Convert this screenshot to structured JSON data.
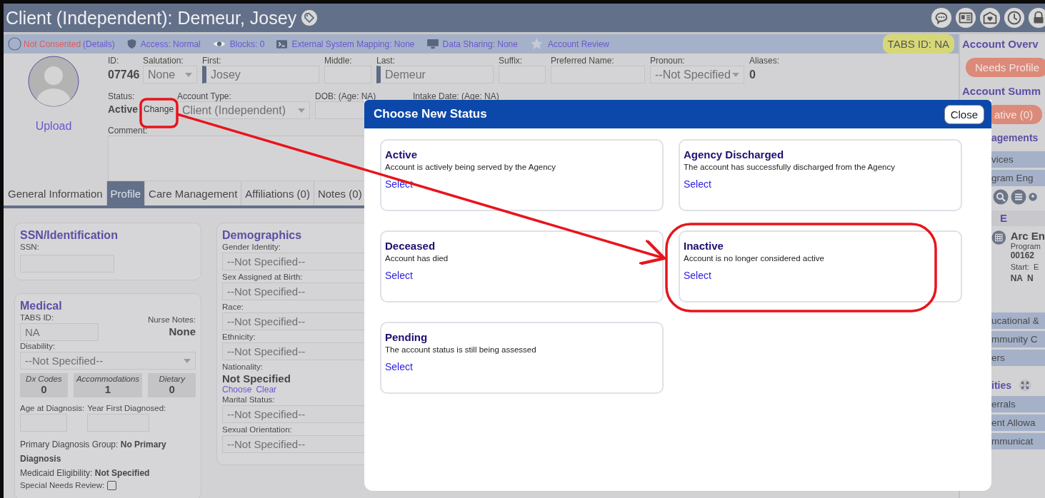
{
  "window": {
    "title": "Client (Independent): Demeur, Josey"
  },
  "info_bar": {
    "consent": {
      "label": "Not Consented",
      "link": "(Details)"
    },
    "items": [
      {
        "kind": "access",
        "label": "Access: Normal"
      },
      {
        "kind": "blocks",
        "label": "Blocks: 0"
      },
      {
        "kind": "external",
        "label": "External System Mapping: None"
      },
      {
        "kind": "sharing",
        "label": "Data Sharing: None"
      },
      {
        "kind": "review",
        "label": "Account Review"
      }
    ],
    "tabs_id": "TABS ID: NA"
  },
  "profile": {
    "upload": "Upload",
    "id": {
      "label": "ID:",
      "value": "07746"
    },
    "salutation": {
      "label": "Salutation:",
      "value": "None"
    },
    "first": {
      "label": "First:",
      "value": "Josey"
    },
    "middle": {
      "label": "Middle:"
    },
    "last": {
      "label": "Last:",
      "value": "Demeur"
    },
    "suffix": {
      "label": "Suffix:"
    },
    "preferred_name": {
      "label": "Preferred Name:"
    },
    "pronoun": {
      "label": "Pronoun:",
      "value": "--Not Specified"
    },
    "aliases": {
      "label": "Aliases:",
      "value": "0"
    },
    "status": {
      "label": "Status:",
      "value": "Active",
      "button": "Change"
    },
    "account_type": {
      "label": "Account Type:",
      "value": "Client (Independent)"
    },
    "dob": {
      "label": "DOB: (Age: NA)"
    },
    "intake_date": {
      "label": "Intake Date: (Age: NA)"
    },
    "comment": {
      "label": "Comment:"
    }
  },
  "tabs": [
    {
      "label": "General Information",
      "selected": false
    },
    {
      "label": "Profile",
      "selected": true
    },
    {
      "label": "Care Management",
      "selected": false
    },
    {
      "label": "Affiliations (0)",
      "selected": false
    },
    {
      "label": "Notes (0)",
      "selected": false
    }
  ],
  "ssn": {
    "title": "SSN/Identification",
    "label": "SSN:"
  },
  "medical": {
    "title": "Medical",
    "tabs_id": {
      "label": "TABS ID:",
      "value": "NA"
    },
    "nurse_notes": {
      "label": "Nurse Notes:",
      "value": "None"
    },
    "disability": {
      "label": "Disability:",
      "value": "--Not Specified--"
    },
    "counts": [
      {
        "label": "Dx Codes",
        "value": "0"
      },
      {
        "label": "Accommodations",
        "value": "1"
      },
      {
        "label": "Dietary",
        "value": "0"
      }
    ],
    "age_at_diagnosis": {
      "label": "Age at Diagnosis:"
    },
    "year_first_diagnosed": {
      "label": "Year First Diagnosed:"
    },
    "primary_diagnosis": "Primary Diagnosis Group: **No Primary Diagnosis**",
    "medicaid": "Medicaid Eligibility: **Not Specified**",
    "special_needs": {
      "label": "Special Needs Review:",
      "checked": false
    }
  },
  "demographics": {
    "title": "Demographics",
    "fields": [
      {
        "kind": "select",
        "label": "Gender Identity:",
        "value": "--Not Specified--"
      },
      {
        "kind": "select",
        "label": "Sex Assigned at Birth:",
        "value": "--Not Specified--"
      },
      {
        "kind": "select",
        "label": "Race:",
        "value": "--Not Specified--"
      },
      {
        "kind": "select",
        "label": "Ethnicity:",
        "value": "--Not Specified--"
      },
      {
        "kind": "choice",
        "label": "Nationality:",
        "value": "Not Specified",
        "links": [
          "Choose",
          "Clear"
        ]
      },
      {
        "kind": "select",
        "label": "Marital Status:",
        "value": "--Not Specified--"
      },
      {
        "kind": "select",
        "label": "Sexual Orientation:",
        "value": "--Not Specified--"
      }
    ]
  },
  "modal": {
    "title": "Choose New Status",
    "close": "Close",
    "options": [
      {
        "title": "Active",
        "description": "Account is actively being served by the Agency",
        "action": "Select"
      },
      {
        "title": "Agency Discharged",
        "description": "The account has successfully discharged from the Agency",
        "action": "Select"
      },
      {
        "title": "Deceased",
        "description": "Account has died",
        "action": "Select"
      },
      {
        "title": "Inactive",
        "description": "Account is no longer considered active",
        "action": "Select"
      },
      {
        "title": "Pending",
        "description": "The account status is still being assessed",
        "action": "Select"
      }
    ]
  },
  "right_panel": {
    "overview_title": "Account Overv",
    "overview_badge": "Needs Profile",
    "summary_title": "Account Summ",
    "summary_badge": "ative (0)",
    "engagements_title": "agements",
    "engagement_rows": [
      "vices",
      "gram Eng"
    ],
    "group": "E",
    "item": {
      "name": "Arc En",
      "program_label": "Program",
      "program": "00162",
      "start_label": "Start:",
      "end_label": "E",
      "start": "NA",
      "end": "N"
    },
    "section_rows": [
      "ucational &",
      "mmunity C",
      "ers"
    ],
    "activities_title": "ities",
    "activity_rows": [
      "errals",
      "ent Allowa",
      "mmunicat"
    ]
  }
}
